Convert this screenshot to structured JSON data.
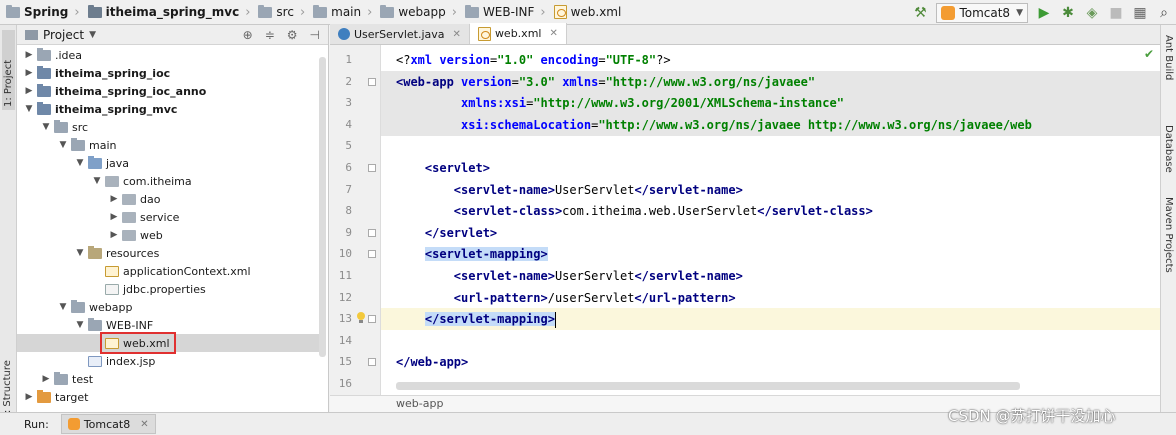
{
  "breadcrumbs": [
    {
      "label": "Spring",
      "bold": true,
      "icon": "folder-icon"
    },
    {
      "label": "itheima_spring_mvc",
      "bold": true,
      "icon": "module-folder-icon"
    },
    {
      "label": "src",
      "bold": false,
      "icon": "folder-icon"
    },
    {
      "label": "main",
      "bold": false,
      "icon": "folder-icon"
    },
    {
      "label": "webapp",
      "bold": false,
      "icon": "folder-icon"
    },
    {
      "label": "WEB-INF",
      "bold": false,
      "icon": "folder-icon"
    },
    {
      "label": "web.xml",
      "bold": false,
      "icon": "xml-file-icon"
    }
  ],
  "toolbar": {
    "run_config": "Tomcat8"
  },
  "sidebar_left": {
    "project_tab": "1: Project",
    "structure_tab": "Z: Structure"
  },
  "sidebar_right": {
    "tabs": [
      "Ant Build",
      "Database",
      "Maven Projects"
    ]
  },
  "project_panel": {
    "title": "Project"
  },
  "tree": [
    {
      "label": ".idea",
      "indent": 1,
      "arrow": "▶",
      "icon": "fold",
      "bold": false
    },
    {
      "label": "itheima_spring_ioc",
      "indent": 1,
      "arrow": "▶",
      "icon": "mod",
      "bold": true
    },
    {
      "label": "itheima_spring_ioc_anno",
      "indent": 1,
      "arrow": "▶",
      "icon": "mod",
      "bold": true
    },
    {
      "label": "itheima_spring_mvc",
      "indent": 1,
      "arrow": "▼",
      "icon": "mod",
      "bold": true
    },
    {
      "label": "src",
      "indent": 2,
      "arrow": "▼",
      "icon": "fold",
      "bold": false
    },
    {
      "label": "main",
      "indent": 3,
      "arrow": "▼",
      "icon": "fold",
      "bold": false
    },
    {
      "label": "java",
      "indent": 4,
      "arrow": "▼",
      "icon": "src",
      "bold": false
    },
    {
      "label": "com.itheima",
      "indent": 5,
      "arrow": "▼",
      "icon": "pkg",
      "bold": false
    },
    {
      "label": "dao",
      "indent": 6,
      "arrow": "▶",
      "icon": "pkg",
      "bold": false
    },
    {
      "label": "service",
      "indent": 6,
      "arrow": "▶",
      "icon": "pkg",
      "bold": false
    },
    {
      "label": "web",
      "indent": 6,
      "arrow": "▶",
      "icon": "pkg",
      "bold": false
    },
    {
      "label": "resources",
      "indent": 4,
      "arrow": "▼",
      "icon": "res",
      "bold": false
    },
    {
      "label": "applicationContext.xml",
      "indent": 5,
      "arrow": "",
      "icon": "xml",
      "bold": false
    },
    {
      "label": "jdbc.properties",
      "indent": 5,
      "arrow": "",
      "icon": "prop",
      "bold": false
    },
    {
      "label": "webapp",
      "indent": 3,
      "arrow": "▼",
      "icon": "fold",
      "bold": false
    },
    {
      "label": "WEB-INF",
      "indent": 4,
      "arrow": "▼",
      "icon": "fold",
      "bold": false
    },
    {
      "label": "web.xml",
      "indent": 5,
      "arrow": "",
      "icon": "xml",
      "bold": false,
      "selected": true,
      "boxed": true
    },
    {
      "label": "index.jsp",
      "indent": 4,
      "arrow": "",
      "icon": "jsp",
      "bold": false
    },
    {
      "label": "test",
      "indent": 2,
      "arrow": "▶",
      "icon": "fold",
      "bold": false
    },
    {
      "label": "target",
      "indent": 1,
      "arrow": "▶",
      "icon": "tgt",
      "bold": false
    }
  ],
  "editor": {
    "tabs": [
      {
        "label": "UserServlet.java",
        "active": false,
        "icon": "java-class-icon"
      },
      {
        "label": "web.xml",
        "active": true,
        "icon": "xml-file-icon"
      }
    ],
    "breadcrumb": "web-app",
    "line_numbers": [
      "1",
      "2",
      "3",
      "4",
      "5",
      "6",
      "7",
      "8",
      "9",
      "10",
      "11",
      "12",
      "13",
      "14",
      "15",
      "16"
    ],
    "lines": [
      [
        [
          "pi",
          "<?"
        ],
        [
          "an",
          "xml "
        ],
        [
          "an",
          "version"
        ],
        [
          "pi",
          "="
        ],
        [
          "av",
          "\"1.0\""
        ],
        [
          "pi",
          " "
        ],
        [
          "an",
          "encoding"
        ],
        [
          "pi",
          "="
        ],
        [
          "av",
          "\"UTF-8\""
        ],
        [
          "pi",
          "?>"
        ]
      ],
      [
        [
          "tg",
          "<web-app "
        ],
        [
          "an",
          "version"
        ],
        [
          "tx",
          "="
        ],
        [
          "av",
          "\"3.0\""
        ],
        [
          "tx",
          " "
        ],
        [
          "an",
          "xmlns"
        ],
        [
          "tx",
          "="
        ],
        [
          "av",
          "\"http://www.w3.org/ns/javaee\""
        ]
      ],
      [
        [
          "tx",
          "         "
        ],
        [
          "an",
          "xmlns:xsi"
        ],
        [
          "tx",
          "="
        ],
        [
          "av",
          "\"http://www.w3.org/2001/XMLSchema-instance\""
        ]
      ],
      [
        [
          "tx",
          "         "
        ],
        [
          "an",
          "xsi:schemaLocation"
        ],
        [
          "tx",
          "="
        ],
        [
          "av",
          "\"http://www.w3.org/ns/javaee http://www.w3.org/ns/javaee/web"
        ]
      ],
      [],
      [
        [
          "tx",
          "    "
        ],
        [
          "tg",
          "<servlet>"
        ]
      ],
      [
        [
          "tx",
          "        "
        ],
        [
          "tg",
          "<servlet-name>"
        ],
        [
          "tx",
          "UserServlet"
        ],
        [
          "tg",
          "</servlet-name>"
        ]
      ],
      [
        [
          "tx",
          "        "
        ],
        [
          "tg",
          "<servlet-class>"
        ],
        [
          "tx",
          "com.itheima.web.UserServlet"
        ],
        [
          "tg",
          "</servlet-class>"
        ]
      ],
      [
        [
          "tx",
          "    "
        ],
        [
          "tg",
          "</servlet>"
        ]
      ],
      [
        [
          "tx",
          "    "
        ],
        [
          "tg hlt",
          "<servlet-mapping>"
        ]
      ],
      [
        [
          "tx",
          "        "
        ],
        [
          "tg",
          "<servlet-name>"
        ],
        [
          "tx",
          "UserServlet"
        ],
        [
          "tg",
          "</servlet-name>"
        ]
      ],
      [
        [
          "tx",
          "        "
        ],
        [
          "tg",
          "<url-pattern>"
        ],
        [
          "tx",
          "/userServlet"
        ],
        [
          "tg",
          "</url-pattern>"
        ]
      ],
      [
        [
          "tx",
          "    "
        ],
        [
          "tg hlt",
          "</servlet-mapping>"
        ]
      ],
      [],
      [
        [
          "tg",
          "</web-app>"
        ]
      ],
      []
    ]
  },
  "run_bar": {
    "label": "Run:",
    "tab": "Tomcat8"
  },
  "watermark": "CSDN @苏打饼干没加心"
}
